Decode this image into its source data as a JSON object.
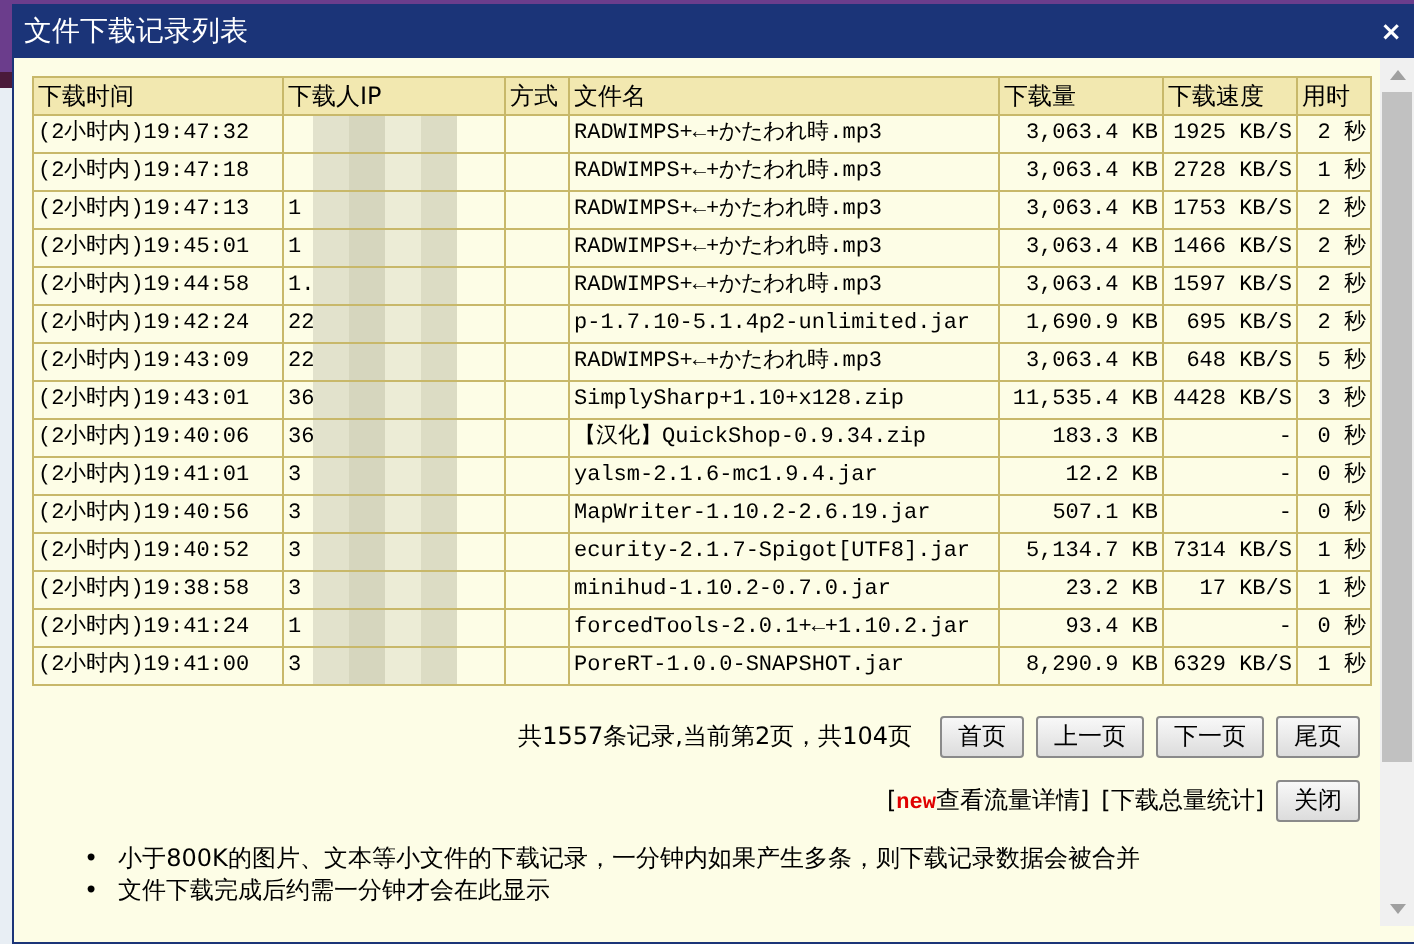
{
  "window": {
    "title": "文件下载记录列表",
    "close": "×"
  },
  "table": {
    "columns": [
      "下载时间",
      "下载人IP",
      "方式",
      "文件名",
      "下载量",
      "下载速度",
      "用时"
    ],
    "rows": [
      {
        "time": "(2小时内)19:47:32",
        "ip": "",
        "method": "",
        "file": "RADWIMPS+←+かたわれ時.mp3",
        "size": "3,063.4 KB",
        "speed": "1925 KB/S",
        "duration": "2 秒"
      },
      {
        "time": "(2小时内)19:47:18",
        "ip": "",
        "method": "",
        "file": "RADWIMPS+←+かたわれ時.mp3",
        "size": "3,063.4 KB",
        "speed": "2728 KB/S",
        "duration": "1 秒"
      },
      {
        "time": "(2小时内)19:47:13",
        "ip": "1",
        "method": "",
        "file": "RADWIMPS+←+かたわれ時.mp3",
        "size": "3,063.4 KB",
        "speed": "1753 KB/S",
        "duration": "2 秒"
      },
      {
        "time": "(2小时内)19:45:01",
        "ip": "1",
        "method": "",
        "file": "RADWIMPS+←+かたわれ時.mp3",
        "size": "3,063.4 KB",
        "speed": "1466 KB/S",
        "duration": "2 秒"
      },
      {
        "time": "(2小时内)19:44:58",
        "ip": "1.",
        "method": "",
        "file": "RADWIMPS+←+かたわれ時.mp3",
        "size": "3,063.4 KB",
        "speed": "1597 KB/S",
        "duration": "2 秒"
      },
      {
        "time": "(2小时内)19:42:24",
        "ip": "22",
        "method": "",
        "file": "p-1.7.10-5.1.4p2-unlimited.jar",
        "size": "1,690.9 KB",
        "speed": "695 KB/S",
        "duration": "2 秒"
      },
      {
        "time": "(2小时内)19:43:09",
        "ip": "22",
        "method": "",
        "file": "RADWIMPS+←+かたわれ時.mp3",
        "size": "3,063.4 KB",
        "speed": "648 KB/S",
        "duration": "5 秒"
      },
      {
        "time": "(2小时内)19:43:01",
        "ip": "36",
        "method": "",
        "file": "SimplySharp+1.10+x128.zip",
        "size": "11,535.4 KB",
        "speed": "4428 KB/S",
        "duration": "3 秒"
      },
      {
        "time": "(2小时内)19:40:06",
        "ip": "36",
        "method": "",
        "file": "【汉化】QuickShop-0.9.34.zip",
        "size": "183.3 KB",
        "speed": "-",
        "duration": "0 秒"
      },
      {
        "time": "(2小时内)19:41:01",
        "ip": "3",
        "method": "",
        "file": "yalsm-2.1.6-mc1.9.4.jar",
        "size": "12.2 KB",
        "speed": "-",
        "duration": "0 秒"
      },
      {
        "time": "(2小时内)19:40:56",
        "ip": "3",
        "method": "",
        "file": "MapWriter-1.10.2-2.6.19.jar",
        "size": "507.1 KB",
        "speed": "-",
        "duration": "0 秒"
      },
      {
        "time": "(2小时内)19:40:52",
        "ip": "3",
        "method": "",
        "file": "ecurity-2.1.7-Spigot[UTF8].jar",
        "size": "5,134.7 KB",
        "speed": "7314 KB/S",
        "duration": "1 秒"
      },
      {
        "time": "(2小时内)19:38:58",
        "ip": "3",
        "method": "",
        "file": "minihud-1.10.2-0.7.0.jar",
        "size": "23.2 KB",
        "speed": "17 KB/S",
        "duration": "1 秒"
      },
      {
        "time": "(2小时内)19:41:24",
        "ip": "1",
        "method": "",
        "file": "forcedTools-2.0.1+←+1.10.2.jar",
        "size": "93.4 KB",
        "speed": "-",
        "duration": "0 秒"
      },
      {
        "time": "(2小时内)19:41:00",
        "ip": "3",
        "method": "",
        "file": "PoreRT-1.0.0-SNAPSHOT.jar",
        "size": "8,290.9 KB",
        "speed": "6329 KB/S",
        "duration": "1 秒"
      }
    ]
  },
  "pagination": {
    "summary": "共1557条记录,当前第2页，共104页",
    "buttons": [
      "首页",
      "上一页",
      "下一页",
      "尾页"
    ]
  },
  "links": [
    {
      "open": "[",
      "badge": "new",
      "label": "查看流量详情",
      "close": "]"
    },
    {
      "open": "[",
      "label": "下载总量统计",
      "close": "]"
    }
  ],
  "close_button": "关闭",
  "notes": [
    {
      "marker": "•",
      "text": "小于800K的图片、文本等小文件的下载记录，一分钟内如果产生多条，则下载记录数据会被合并"
    },
    {
      "marker": "•",
      "text": "文件下载完成后约需一分钟才会在此显示"
    }
  ]
}
